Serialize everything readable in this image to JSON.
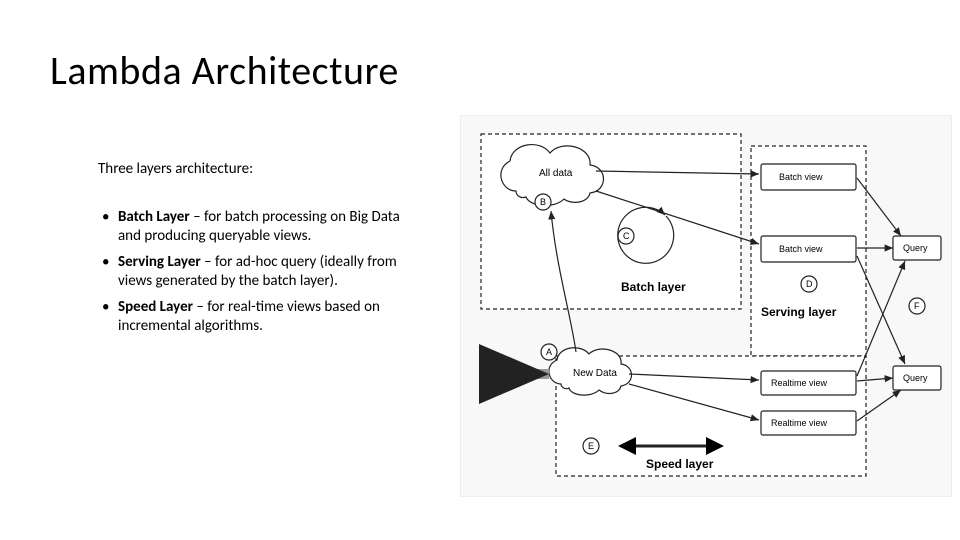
{
  "title": "Lambda Architecture",
  "intro": "Three layers architecture:",
  "bullets": [
    {
      "name": "Batch Layer",
      "desc": " – for batch processing on Big Data and producing queryable views."
    },
    {
      "name": "Serving Layer",
      "desc": " – for ad-hoc query (ideally from views generated by the batch layer)."
    },
    {
      "name": "Speed Layer",
      "desc": " – for real-time views based on incremental algorithms."
    }
  ],
  "diagram": {
    "layers": {
      "batch": "Batch layer",
      "serving": "Serving layer",
      "speed": "Speed layer"
    },
    "nodes": {
      "all_data": "All data",
      "new_data": "New Data",
      "batch_view_1": "Batch view",
      "batch_view_2": "Batch view",
      "realtime_view_1": "Realtime view",
      "realtime_view_2": "Realtime view",
      "query_1": "Query",
      "query_2": "Query"
    },
    "markers": {
      "a": "A",
      "b": "B",
      "c": "C",
      "d": "D",
      "e": "E",
      "f": "F"
    }
  }
}
